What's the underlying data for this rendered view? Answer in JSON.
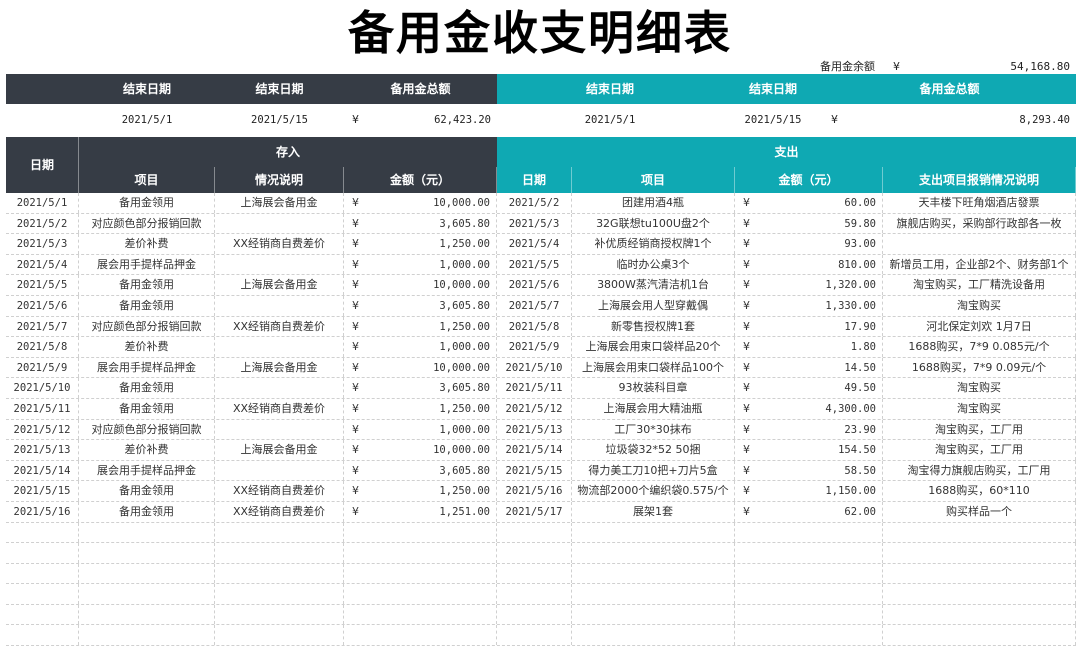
{
  "title": "备用金收支明细表",
  "balance": {
    "label": "备用金余额",
    "currency": "¥",
    "value": "54,168.80"
  },
  "summary": {
    "left_headers": [
      "结束日期",
      "结束日期",
      "备用金总额"
    ],
    "right_headers": [
      "结束日期",
      "结束日期",
      "备用金总额"
    ],
    "left_values": {
      "start": "2021/5/1",
      "end": "2021/5/15",
      "currency": "¥",
      "total": "62,423.20"
    },
    "right_values": {
      "start": "2021/5/1",
      "end": "2021/5/15",
      "currency": "¥",
      "total": "8,293.40"
    }
  },
  "headers": {
    "date": "日期",
    "income_group": "存入",
    "expense_group": "支出",
    "income_cols": [
      "项目",
      "情况说明",
      "金额（元）"
    ],
    "expense_cols": [
      "日期",
      "项目",
      "金额（元）",
      "支出项目报销情况说明"
    ]
  },
  "rows": [
    {
      "date": "2021/5/1",
      "item": "备用金领用",
      "note": "上海展会备用金",
      "cur": "¥",
      "amount": "10,000.00",
      "edate": "2021/5/2",
      "eitem": "团建用酒4瓶",
      "ecur": "¥",
      "eamount": "60.00",
      "enote": "天丰楼下旺角烟酒店發票"
    },
    {
      "date": "2021/5/2",
      "item": "对应颜色部分报销回款",
      "note": "",
      "cur": "¥",
      "amount": "3,605.80",
      "edate": "2021/5/3",
      "eitem": "32G联想tu100U盘2个",
      "ecur": "¥",
      "eamount": "59.80",
      "enote": "旗舰店购买，采购部行政部各一枚"
    },
    {
      "date": "2021/5/3",
      "item": "差价补费",
      "note": "XX经销商自费差价",
      "cur": "¥",
      "amount": "1,250.00",
      "edate": "2021/5/4",
      "eitem": "补优质经销商授权牌1个",
      "ecur": "¥",
      "eamount": "93.00",
      "enote": ""
    },
    {
      "date": "2021/5/4",
      "item": "展会用手提样品押金",
      "note": "",
      "cur": "¥",
      "amount": "1,000.00",
      "edate": "2021/5/5",
      "eitem": "临时办公桌3个",
      "ecur": "¥",
      "eamount": "810.00",
      "enote": "新增员工用，企业部2个、财务部1个"
    },
    {
      "date": "2021/5/5",
      "item": "备用金领用",
      "note": "上海展会备用金",
      "cur": "¥",
      "amount": "10,000.00",
      "edate": "2021/5/6",
      "eitem": "3800W蒸汽清洁机1台",
      "ecur": "¥",
      "eamount": "1,320.00",
      "enote": "淘宝购买，工厂精洗设备用"
    },
    {
      "date": "2021/5/6",
      "item": "备用金领用",
      "note": "",
      "cur": "¥",
      "amount": "3,605.80",
      "edate": "2021/5/7",
      "eitem": "上海展会用人型穿戴偶",
      "ecur": "¥",
      "eamount": "1,330.00",
      "enote": "淘宝购买"
    },
    {
      "date": "2021/5/7",
      "item": "对应颜色部分报销回款",
      "note": "XX经销商自费差价",
      "cur": "¥",
      "amount": "1,250.00",
      "edate": "2021/5/8",
      "eitem": "新零售授权牌1套",
      "ecur": "¥",
      "eamount": "17.90",
      "enote": "河北保定刘欢 1月7日"
    },
    {
      "date": "2021/5/8",
      "item": "差价补费",
      "note": "",
      "cur": "¥",
      "amount": "1,000.00",
      "edate": "2021/5/9",
      "eitem": "上海展会用束口袋样品20个",
      "ecur": "¥",
      "eamount": "1.80",
      "enote": "1688购买，7*9  0.085元/个"
    },
    {
      "date": "2021/5/9",
      "item": "展会用手提样品押金",
      "note": "上海展会备用金",
      "cur": "¥",
      "amount": "10,000.00",
      "edate": "2021/5/10",
      "eitem": "上海展会用束口袋样品100个",
      "ecur": "¥",
      "eamount": "14.50",
      "enote": "1688购买，7*9  0.09元/个"
    },
    {
      "date": "2021/5/10",
      "item": "备用金领用",
      "note": "",
      "cur": "¥",
      "amount": "3,605.80",
      "edate": "2021/5/11",
      "eitem": "93枚装科目章",
      "ecur": "¥",
      "eamount": "49.50",
      "enote": "淘宝购买"
    },
    {
      "date": "2021/5/11",
      "item": "备用金领用",
      "note": "XX经销商自费差价",
      "cur": "¥",
      "amount": "1,250.00",
      "edate": "2021/5/12",
      "eitem": "上海展会用大精油瓶",
      "ecur": "¥",
      "eamount": "4,300.00",
      "enote": "淘宝购买"
    },
    {
      "date": "2021/5/12",
      "item": "对应颜色部分报销回款",
      "note": "",
      "cur": "¥",
      "amount": "1,000.00",
      "edate": "2021/5/13",
      "eitem": "工厂30*30抹布",
      "ecur": "¥",
      "eamount": "23.90",
      "enote": "淘宝购买，工厂用"
    },
    {
      "date": "2021/5/13",
      "item": "差价补费",
      "note": "上海展会备用金",
      "cur": "¥",
      "amount": "10,000.00",
      "edate": "2021/5/14",
      "eitem": "垃圾袋32*52 50捆",
      "ecur": "¥",
      "eamount": "154.50",
      "enote": "淘宝购买，工厂用"
    },
    {
      "date": "2021/5/14",
      "item": "展会用手提样品押金",
      "note": "",
      "cur": "¥",
      "amount": "3,605.80",
      "edate": "2021/5/15",
      "eitem": "得力美工刀10把+刀片5盒",
      "ecur": "¥",
      "eamount": "58.50",
      "enote": "淘宝得力旗舰店购买，工厂用"
    },
    {
      "date": "2021/5/15",
      "item": "备用金领用",
      "note": "XX经销商自费差价",
      "cur": "¥",
      "amount": "1,250.00",
      "edate": "2021/5/16",
      "eitem": "物流部2000个编织袋0.575/个",
      "ecur": "¥",
      "eamount": "1,150.00",
      "enote": "1688购买，60*110"
    },
    {
      "date": "2021/5/16",
      "item": "备用金领用",
      "note": "XX经销商自费差价",
      "cur": "¥",
      "amount": "1,251.00",
      "edate": "2021/5/17",
      "eitem": "展架1套",
      "ecur": "¥",
      "eamount": "62.00",
      "enote": "购买样品一个"
    }
  ]
}
